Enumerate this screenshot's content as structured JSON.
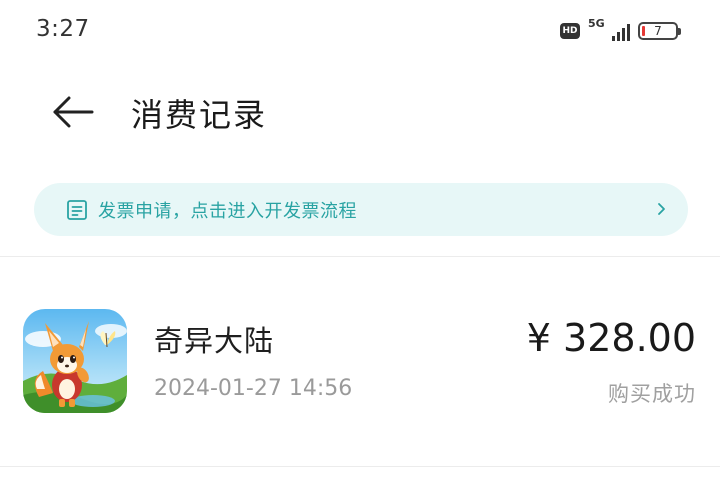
{
  "status_bar": {
    "time": "3:27",
    "hd": "HD",
    "network": "5G",
    "battery_level": "7"
  },
  "header": {
    "back_icon": "arrow-left-icon",
    "title": "消费记录"
  },
  "invoice_banner": {
    "icon": "receipt-icon",
    "text": "发票申请，点击进入开发票流程",
    "chevron_icon": "chevron-right-icon",
    "background": "#e7f7f7",
    "accent": "#29a3a3"
  },
  "orders": [
    {
      "app_name": "奇异大陆",
      "time": "2024-01-27 14:56",
      "price": "¥ 328.00",
      "status": "购买成功",
      "icon": "game-app-icon"
    }
  ]
}
